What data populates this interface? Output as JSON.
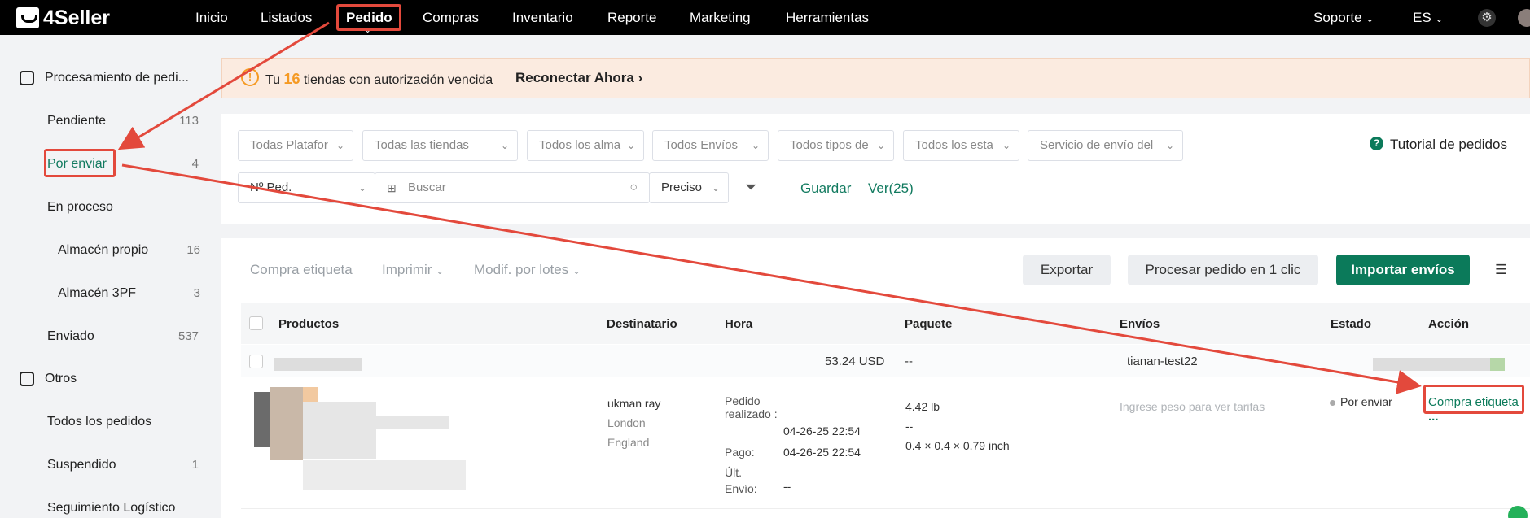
{
  "app": {
    "name": "4Seller"
  },
  "nav": {
    "items": [
      "Inicio",
      "Listados",
      "Pedido",
      "Compras",
      "Inventario",
      "Reporte",
      "Marketing",
      "Herramientas"
    ],
    "support": "Soporte",
    "language": "ES"
  },
  "sidebar": {
    "group1": "Procesamiento de pedi...",
    "pending": {
      "label": "Pendiente",
      "count": "113"
    },
    "to_ship": {
      "label": "Por enviar",
      "count": "4"
    },
    "in_process": {
      "label": "En proceso"
    },
    "own_wh": {
      "label": "Almacén propio",
      "count": "16"
    },
    "tpf_wh": {
      "label": "Almacén 3PF",
      "count": "3"
    },
    "shipped": {
      "label": "Enviado",
      "count": "537"
    },
    "group2": "Otros",
    "all_orders": {
      "label": "Todos los pedidos"
    },
    "suspended": {
      "label": "Suspendido",
      "count": "1"
    },
    "tracking": {
      "label": "Seguimiento Logístico"
    }
  },
  "alert": {
    "prefix": "Tu",
    "count": "16",
    "text": "tiendas con autorización vencida",
    "action": "Reconectar Ahora"
  },
  "filters": {
    "platform": "Todas Platafor",
    "stores": "Todas las tiendas",
    "warehouses": "Todos los alma",
    "shipments": "Todos Envíos",
    "types": "Todos tipos de",
    "states": "Todos los esta",
    "service": "Servicio de envío del",
    "tutorial": "Tutorial de pedidos",
    "order_no": "Nº Ped.",
    "search_placeholder": "Buscar",
    "precision": "Preciso",
    "save": "Guardar",
    "view": "Ver(25)"
  },
  "toolbar": {
    "buy_label": "Compra etiqueta",
    "print": "Imprimir",
    "batch": "Modif. por lotes",
    "export": "Exportar",
    "process_one_click": "Procesar pedido en 1 clic",
    "import_shipments": "Importar envíos"
  },
  "table": {
    "headers": {
      "products": "Productos",
      "recipient": "Destinatario",
      "time": "Hora",
      "package": "Paquete",
      "shipments": "Envíos",
      "state": "Estado",
      "action": "Acción"
    },
    "order": {
      "amount": "53.24 USD",
      "package_dash": "--",
      "store": "tianan-test22",
      "recipient_name": "ukman ray",
      "city": "London",
      "country": "England",
      "placed_label": "Pedido realizado :",
      "placed_value": "04-26-25 22:54",
      "paid_label": "Pago:",
      "paid_value": "04-26-25 22:54",
      "last_ship_label": "Últ. Envío:",
      "last_ship_value": "--",
      "weight": "4.42 lb",
      "weight_dash": "--",
      "dims": "0.4 × 0.4 × 0.79 inch",
      "rate_hint": "Ingrese peso para ver tarifas",
      "status": "Por enviar",
      "action": "Compra etiqueta",
      "more": "..."
    }
  },
  "colors": {
    "brand_green": "#0b7a5a",
    "accent_orange": "#f59a23",
    "annotation_red": "#e3493c"
  }
}
